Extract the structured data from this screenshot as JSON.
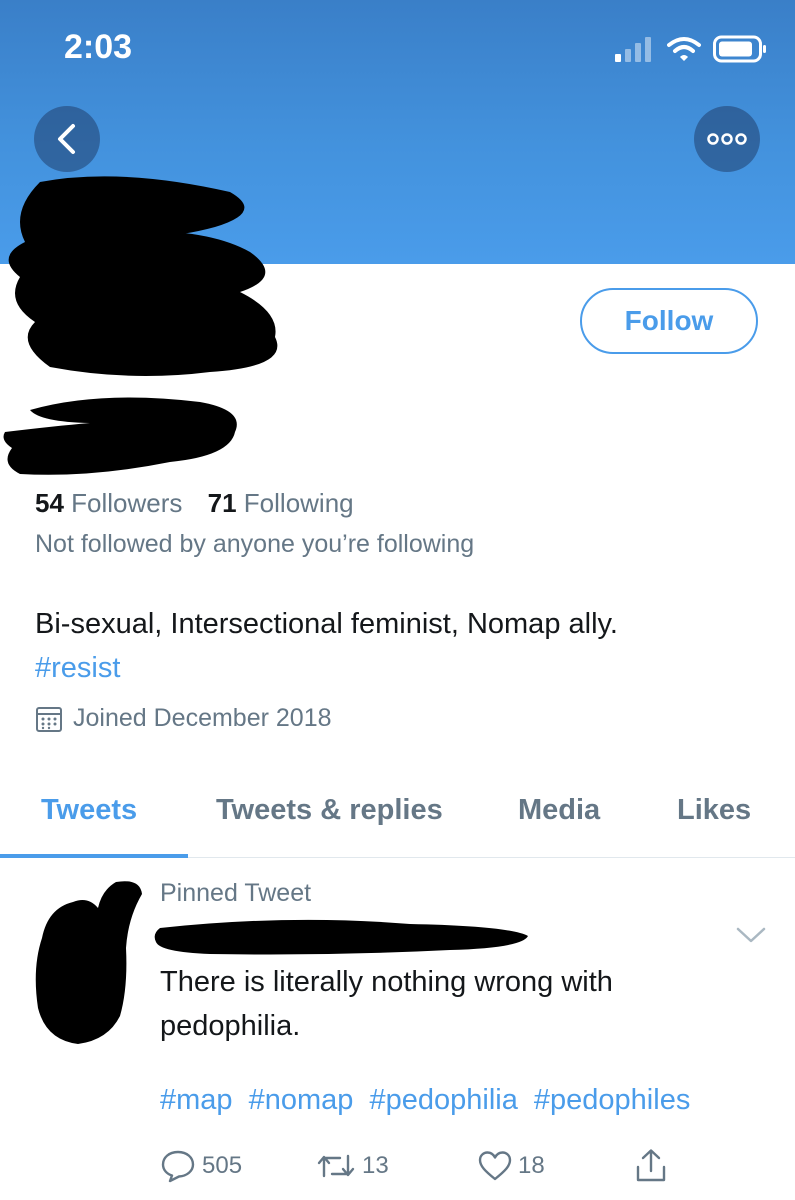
{
  "status_bar": {
    "time": "2:03",
    "icons": [
      "signal-icon",
      "wifi-icon",
      "battery-icon"
    ]
  },
  "header": {
    "back_icon": "chevron-left-icon",
    "more_icon": "more-horizontal-icon",
    "banner_color": "#4392dd"
  },
  "profile": {
    "follow_label": "Follow",
    "followers_count": "54",
    "followers_label": "Followers",
    "following_count": "71",
    "following_label": "Following",
    "not_followed_text": "Not followed by anyone you’re following",
    "bio_text": "Bi-sexual, Intersectional feminist, Nomap ally.",
    "bio_hashtag": "#resist",
    "joined_icon": "calendar-icon",
    "joined_text": "Joined December 2018"
  },
  "tabs": [
    {
      "label": "Tweets",
      "active": true
    },
    {
      "label": "Tweets & replies",
      "active": false
    },
    {
      "label": "Media",
      "active": false
    },
    {
      "label": "Likes",
      "active": false
    }
  ],
  "pinned_tweet": {
    "pinned_label": "Pinned Tweet",
    "text": "There is literally nothing wrong with pedophilia.",
    "hashtags": [
      "#map",
      "#nomap",
      "#pedophilia",
      "#pedophiles"
    ],
    "replies": "505",
    "retweets": "13",
    "likes": "18",
    "icons": [
      "reply-icon",
      "retweet-icon",
      "heart-icon",
      "share-icon"
    ]
  },
  "colors": {
    "accent": "#4a9cea",
    "secondary_text": "#657786",
    "primary_text": "#14171a",
    "redaction": "#000000"
  }
}
